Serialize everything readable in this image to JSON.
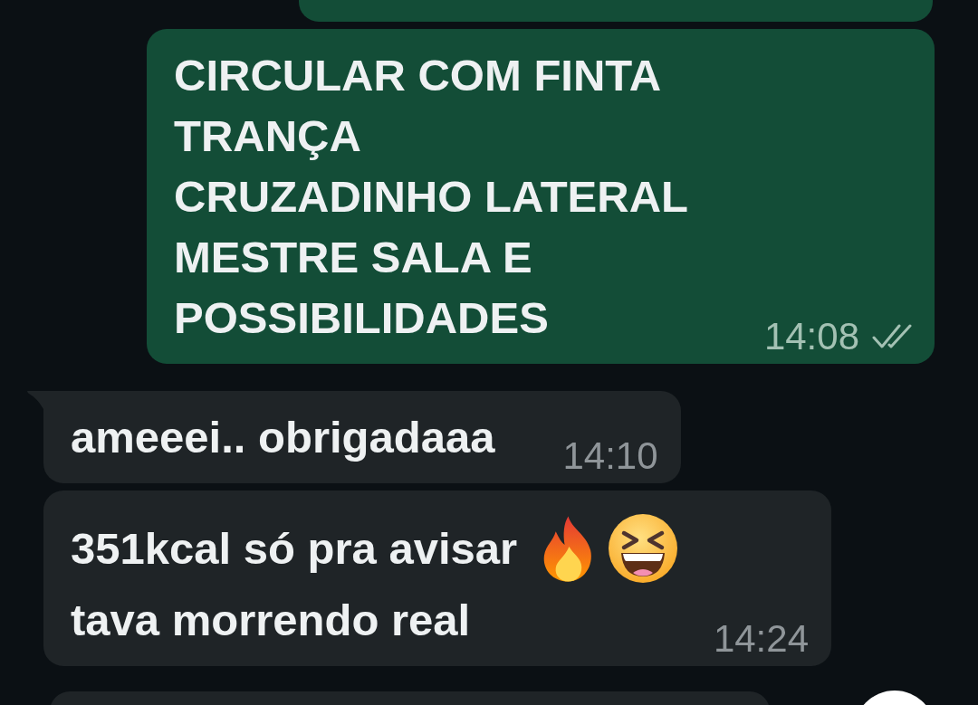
{
  "messages": [
    {
      "kind": "outgoing",
      "lines": [
        {
          "text": "CIRCULAR COM FINTA"
        },
        {
          "text": "TRANÇA"
        },
        {
          "text": "CRUZADINHO LATERAL"
        },
        {
          "text": "MESTRE SALA E"
        },
        {
          "text": "POSSIBILIDADES"
        }
      ],
      "time": "14:08",
      "read": false
    },
    {
      "kind": "incoming",
      "lines": [
        {
          "text": "ameeei.. obrigadaaa"
        }
      ],
      "time": "14:10"
    },
    {
      "kind": "incoming",
      "lines": [
        {
          "text": "351kcal só pra avisar",
          "emojis": [
            {
              "kind": "fire"
            },
            {
              "kind": "laughing"
            }
          ]
        },
        {
          "text": "tava morrendo real"
        }
      ],
      "time": "14:24"
    }
  ]
}
